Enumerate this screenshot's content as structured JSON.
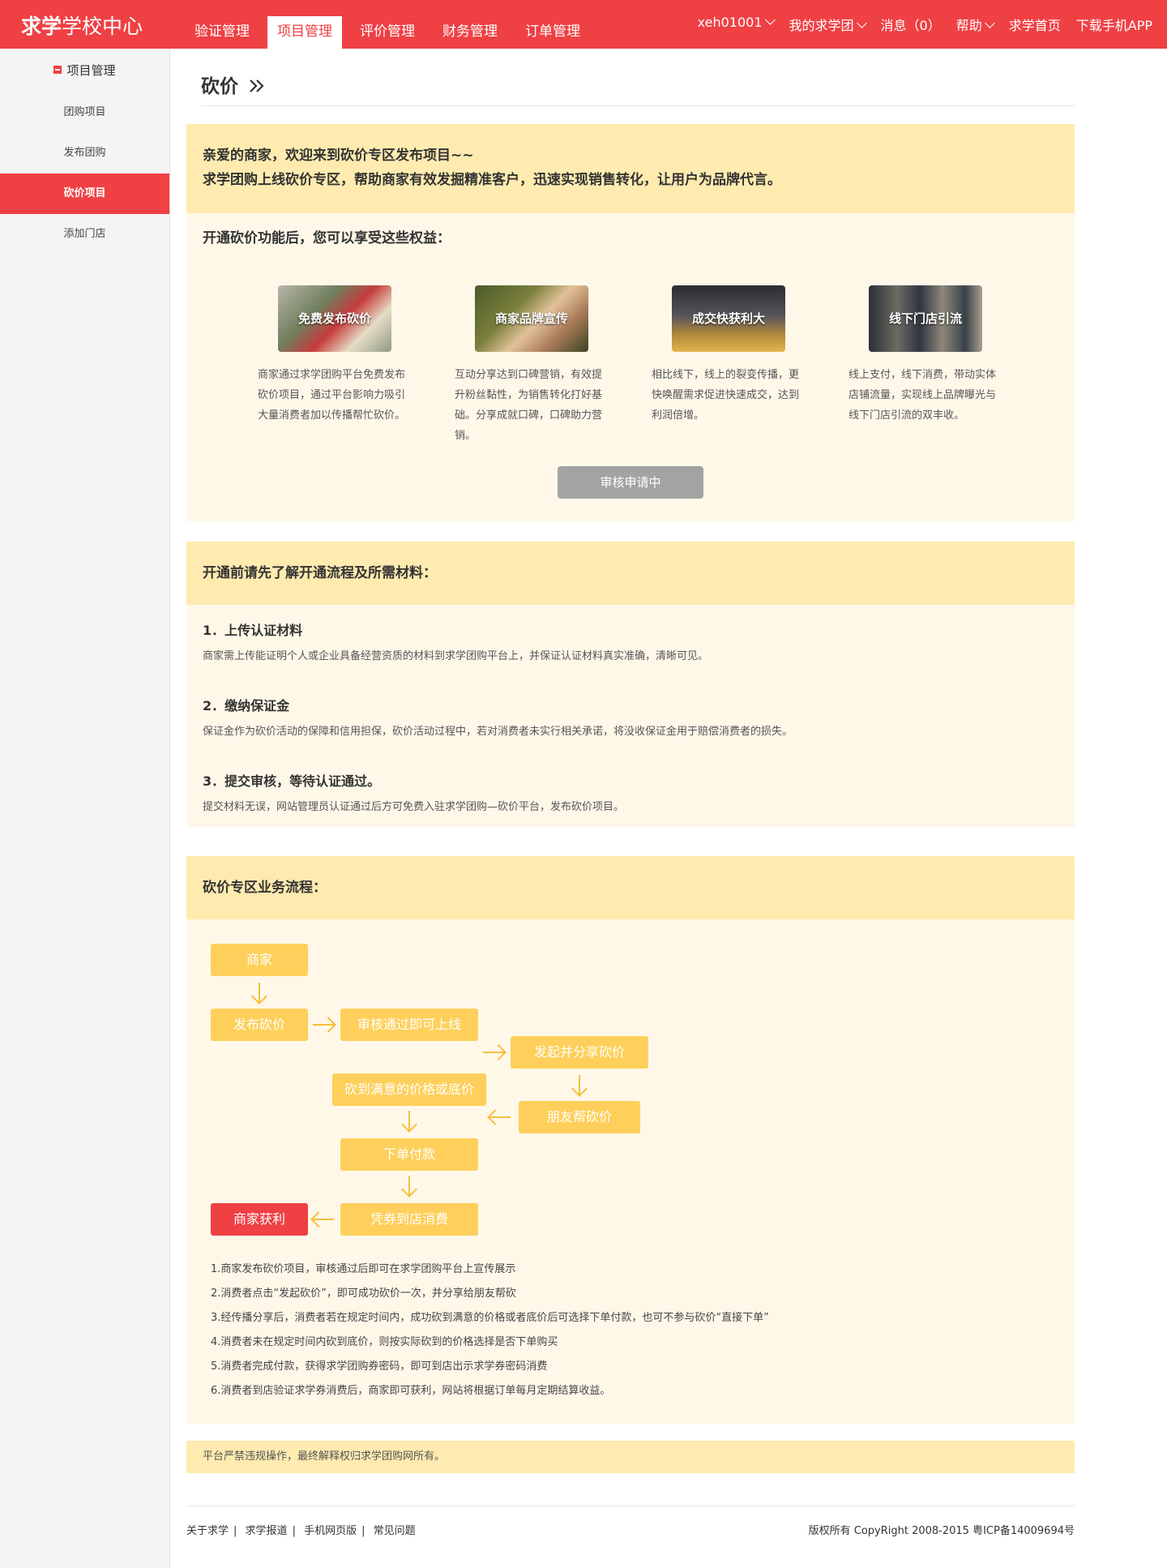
{
  "header": {
    "logo_bold": "求学",
    "logo_rest": "学校中心",
    "nav": [
      "验证管理",
      "项目管理",
      "评价管理",
      "财务管理",
      "订单管理"
    ],
    "user": "xeh01001",
    "group": "我的求学团",
    "messages": "消息（0）",
    "help": "帮助",
    "home": "求学首页",
    "app": "下载手机APP"
  },
  "sidebar": {
    "title": "项目管理",
    "items": [
      "团购项目",
      "发布团购",
      "砍价项目",
      "添加门店"
    ]
  },
  "page": {
    "title": "砍价",
    "intro_line1": "亲爱的商家，欢迎来到砍价专区发布项目~~",
    "intro_line2": "求学团购上线砍价专区，帮助商家有效发掘精准客户，迅速实现销售转化，让用户为品牌代言。",
    "benefit_title": "开通砍价功能后，您可以享受这些权益：",
    "benefits": [
      {
        "label": "免费发布砍价",
        "desc": "商家通过求学团购平台免费发布砍价项目，通过平台影响力吸引大量消费者加以传播帮忙砍价。"
      },
      {
        "label": "商家品牌宣传",
        "desc": "互动分享达到口碑营销，有效提升粉丝黏性，为销售转化打好基础。分享成就口碑，口碑助力营销。"
      },
      {
        "label": "成交快获利大",
        "desc": "相比线下，线上的裂变传播，更快唤醒需求促进快速成交，达到利润倍增。"
      },
      {
        "label": "线下门店引流",
        "desc": "线上支付，线下消费，带动实体店铺流量，实现线上品牌曝光与线下门店引流的双丰收。"
      }
    ],
    "apply_button": "审核申请中",
    "process_title": "开通前请先了解开通流程及所需材料：",
    "steps": [
      {
        "title": "1．上传认证材料",
        "desc": "商家需上传能证明个人或企业具备经营资质的材料到求学团购平台上，并保证认证材料真实准确，清晰可见。"
      },
      {
        "title": "2．缴纳保证金",
        "desc": "保证金作为砍价活动的保障和信用担保，砍价活动过程中，若对消费者未实行相关承诺，将没收保证金用于赔偿消费者的损失。"
      },
      {
        "title": "3．提交审核，等待认证通过。",
        "desc": "提交材料无误，网站管理员认证通过后方可免费入驻求学团购—砍价平台，发布砍价项目。"
      }
    ],
    "flow_title": "砍价专区业务流程：",
    "flow": {
      "merchant": "商家",
      "publish": "发布砍价",
      "review": "审核通过即可上线",
      "share": "发起并分享砍价",
      "friends": "朋友帮砍价",
      "satisfied": "砍到满意的价格或底价",
      "order": "下单付款",
      "consume": "凭券到店消费",
      "profit": "商家获利"
    },
    "notes": [
      "1.商家发布砍价项目，审核通过后即可在求学团购平台上宣传展示",
      "2.消费者点击“发起砍价”，即可成功砍价一次，并分享给朋友帮砍",
      "3.经传播分享后，消费者若在规定时间内，成功砍到满意的价格或者底价后可选择下单付款，也可不参与砍价“直接下单”",
      "4.消费者未在规定时间内砍到底价，则按实际砍到的价格选择是否下单购买",
      "5.消费者完成付款，获得求学团购券密码，即可到店出示求学券密码消费",
      "6.消费者到店验证求学券消费后，商家即可获利，网站将根据订单每月定期结算收益。"
    ],
    "notice": "平台严禁违规操作，最终解释权归求学团购网所有。"
  },
  "footer": {
    "links": [
      "关于求学",
      "求学报道",
      "手机网页版",
      "常见问题"
    ],
    "copyright": "版权所有 CopyRight 2008-2015 粤ICP备14009694号"
  },
  "colors": {
    "brand": "#ef4044",
    "section_head": "#ffebb0",
    "section_bg": "#fff8e9",
    "flow_box": "#fecf5a"
  }
}
